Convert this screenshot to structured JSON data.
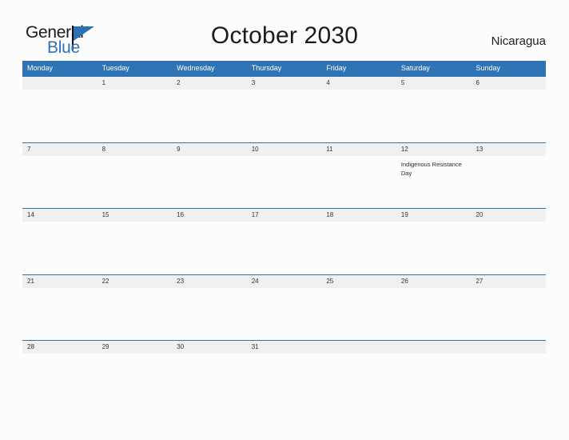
{
  "logo": {
    "word_one": "General",
    "word_two": "Blue",
    "flag_icon": "flag-icon",
    "brand_color": "#2b72b5"
  },
  "header": {
    "title": "October 2030",
    "country": "Nicaragua"
  },
  "calendar": {
    "month": "October",
    "year": "2030",
    "header_bg": "#2e74b5",
    "header_text_color": "#ffffff",
    "day_band_bg": "#f0f0f0",
    "weekdays": [
      "Monday",
      "Tuesday",
      "Wednesday",
      "Thursday",
      "Friday",
      "Saturday",
      "Sunday"
    ],
    "weeks": [
      [
        {
          "date": "",
          "event": ""
        },
        {
          "date": "1",
          "event": ""
        },
        {
          "date": "2",
          "event": ""
        },
        {
          "date": "3",
          "event": ""
        },
        {
          "date": "4",
          "event": ""
        },
        {
          "date": "5",
          "event": ""
        },
        {
          "date": "6",
          "event": ""
        }
      ],
      [
        {
          "date": "7",
          "event": ""
        },
        {
          "date": "8",
          "event": ""
        },
        {
          "date": "9",
          "event": ""
        },
        {
          "date": "10",
          "event": ""
        },
        {
          "date": "11",
          "event": ""
        },
        {
          "date": "12",
          "event": "Indigenous Resistance Day"
        },
        {
          "date": "13",
          "event": ""
        }
      ],
      [
        {
          "date": "14",
          "event": ""
        },
        {
          "date": "15",
          "event": ""
        },
        {
          "date": "16",
          "event": ""
        },
        {
          "date": "17",
          "event": ""
        },
        {
          "date": "18",
          "event": ""
        },
        {
          "date": "19",
          "event": ""
        },
        {
          "date": "20",
          "event": ""
        }
      ],
      [
        {
          "date": "21",
          "event": ""
        },
        {
          "date": "22",
          "event": ""
        },
        {
          "date": "23",
          "event": ""
        },
        {
          "date": "24",
          "event": ""
        },
        {
          "date": "25",
          "event": ""
        },
        {
          "date": "26",
          "event": ""
        },
        {
          "date": "27",
          "event": ""
        }
      ],
      [
        {
          "date": "28",
          "event": ""
        },
        {
          "date": "29",
          "event": ""
        },
        {
          "date": "30",
          "event": ""
        },
        {
          "date": "31",
          "event": ""
        },
        {
          "date": "",
          "event": ""
        },
        {
          "date": "",
          "event": ""
        },
        {
          "date": "",
          "event": ""
        }
      ]
    ]
  }
}
